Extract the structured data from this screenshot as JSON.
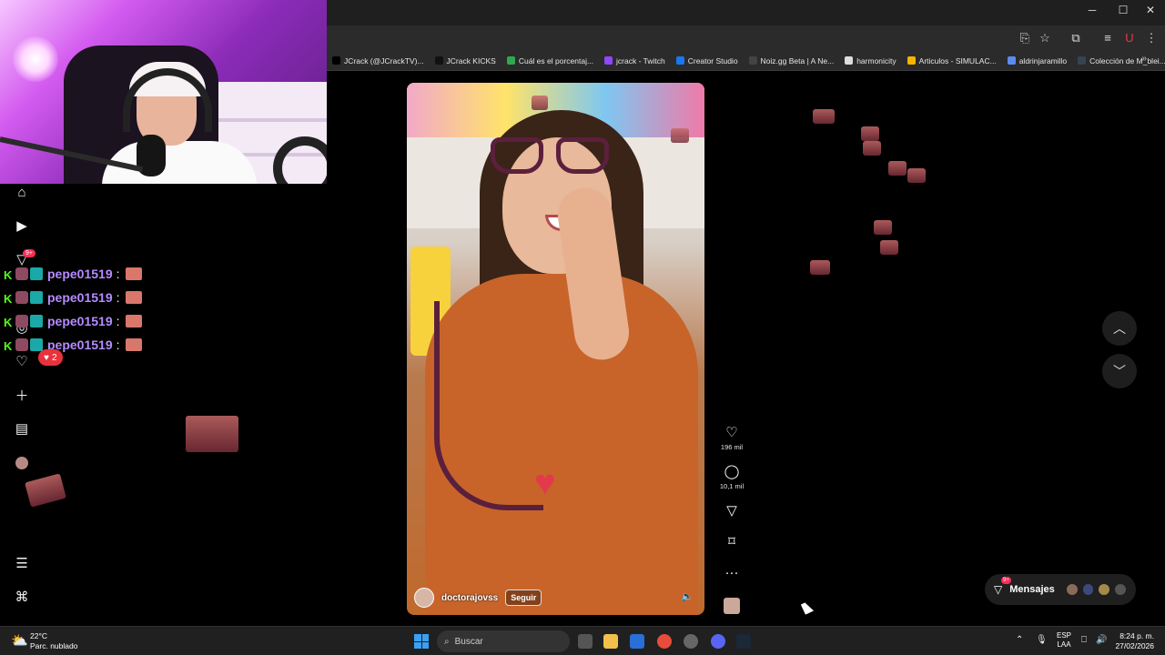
{
  "browser": {
    "bookmarks": [
      {
        "label": "JCrack (@JCrackTV)...",
        "icon": "x-icon",
        "color": "#000000"
      },
      {
        "label": "JCrack KICKS",
        "icon": "tiktok-icon",
        "color": "#111111"
      },
      {
        "label": "Cuál es el porcentaj...",
        "icon": "doc-icon",
        "color": "#2fa84f"
      },
      {
        "label": "jcrack - Twitch",
        "icon": "twitch-icon",
        "color": "#9146ff"
      },
      {
        "label": "Creator Studio",
        "icon": "facebook-icon",
        "color": "#1877f2"
      },
      {
        "label": "Noiz.gg Beta | A Ne...",
        "icon": "noiz-icon",
        "color": "#444444"
      },
      {
        "label": "harmonicity",
        "icon": "page-icon",
        "color": "#dddddd"
      },
      {
        "label": "Articulos - SIMULAC...",
        "icon": "drive-icon",
        "color": "#f4b400"
      },
      {
        "label": "aldrinjaramillo",
        "icon": "page-icon",
        "color": "#5b8def"
      },
      {
        "label": "Colección de M_blei...",
        "icon": "globe-icon",
        "color": "#334455"
      }
    ],
    "more": "»"
  },
  "nav": {
    "messages_badge": "9+"
  },
  "chat": {
    "lines": [
      {
        "user": "pepe01519",
        "sep": ":"
      },
      {
        "user": "pepe01519",
        "sep": ":"
      },
      {
        "user": "pepe01519",
        "sep": ":"
      },
      {
        "user": "pepe01519",
        "sep": ":"
      }
    ],
    "likes": "2"
  },
  "video": {
    "username": "doctorajovss",
    "follow_label": "Seguir",
    "likes": "196 mil",
    "comments": "10,1 mil",
    "more": "···"
  },
  "messages": {
    "label": "Mensajes",
    "badge": "9+"
  },
  "taskbar": {
    "temperature": "22°C",
    "weather": "Parc. nublado",
    "search_placeholder": "Buscar",
    "lang_top": "ESP",
    "lang_bottom": "LAA",
    "time": "8:24 p. m.",
    "date": "27/02/2026"
  },
  "colors": {
    "accent": "#fe2c55",
    "chat_user": "#b58cff",
    "kick_green": "#53fc18"
  }
}
